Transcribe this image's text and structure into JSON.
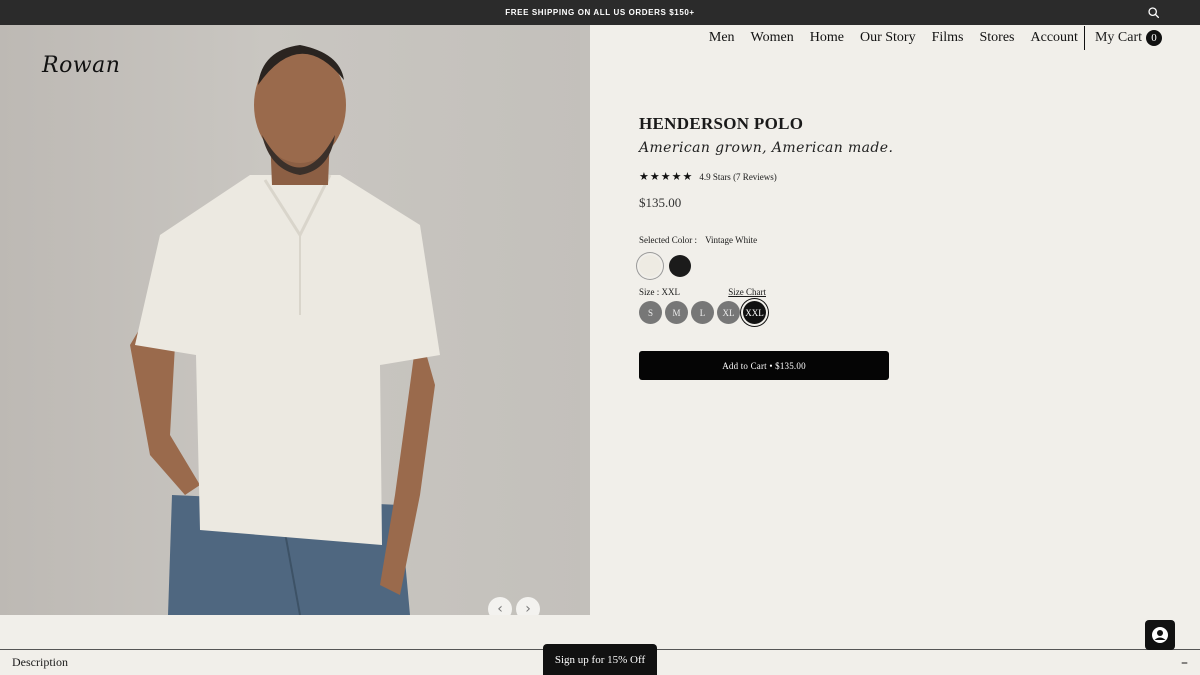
{
  "announcement": {
    "text": "FREE SHIPPING ON ALL US ORDERS $150+"
  },
  "brand": {
    "logo_text": "Rowan"
  },
  "nav": {
    "items": [
      "Men",
      "Women",
      "Home",
      "Our Story",
      "Films",
      "Stores",
      "Account"
    ],
    "cart_label": "My Cart",
    "cart_count": "0"
  },
  "product": {
    "title": "HENDERSON POLO",
    "tagline": "American grown, American made.",
    "stars": "★★★★★",
    "rating_text": "4.9 Stars (7 Reviews)",
    "price": "$135.00",
    "color_label": "Selected Color :",
    "color_value": "Vintage White",
    "size_label": "Size : XXL",
    "size_chart_label": "Size Chart",
    "sizes": [
      "S",
      "M",
      "L",
      "XL",
      "XXL"
    ],
    "selected_size": "XXL",
    "add_to_cart_label": "Add to Cart • $135.00"
  },
  "carousel": {
    "prev_icon": "‹",
    "next_icon": "›"
  },
  "bottom": {
    "description_label": "Description",
    "description_toggle": "–",
    "signup_label": "Sign up for 15% Off"
  },
  "colors": {
    "swatch_white": "#eeebe3",
    "swatch_black": "#1b1b1b",
    "button": "#050505"
  }
}
